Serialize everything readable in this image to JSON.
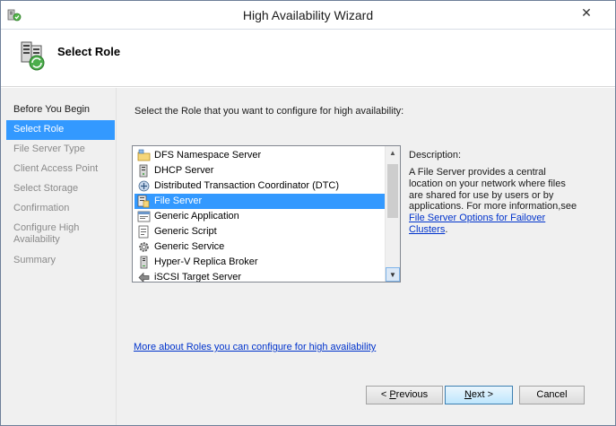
{
  "window": {
    "title": "High Availability Wizard",
    "close_glyph": "✕"
  },
  "header": {
    "title": "Select Role"
  },
  "nav": {
    "items": [
      {
        "label": "Before You Begin",
        "state": "done"
      },
      {
        "label": "Select Role",
        "state": "active"
      },
      {
        "label": "File Server Type",
        "state": "pending"
      },
      {
        "label": "Client Access Point",
        "state": "pending"
      },
      {
        "label": "Select Storage",
        "state": "pending"
      },
      {
        "label": "Confirmation",
        "state": "pending"
      },
      {
        "label": "Configure High Availability",
        "state": "pending"
      },
      {
        "label": "Summary",
        "state": "pending"
      }
    ]
  },
  "main": {
    "instruction": "Select the Role that you want to configure for high availability:",
    "roles": [
      {
        "label": "DFS Namespace Server",
        "icon": "dfs-namespace-icon"
      },
      {
        "label": "DHCP Server",
        "icon": "dhcp-server-icon"
      },
      {
        "label": "Distributed Transaction Coordinator (DTC)",
        "icon": "dtc-icon"
      },
      {
        "label": "File Server",
        "icon": "file-server-icon"
      },
      {
        "label": "Generic Application",
        "icon": "generic-application-icon"
      },
      {
        "label": "Generic Script",
        "icon": "generic-script-icon"
      },
      {
        "label": "Generic Service",
        "icon": "generic-service-icon"
      },
      {
        "label": "Hyper-V Replica Broker",
        "icon": "hyperv-replica-broker-icon"
      },
      {
        "label": "iSCSI Target Server",
        "icon": "iscsi-target-server-icon"
      }
    ],
    "selected_role": "File Server",
    "description_label": "Description:",
    "description_text": "A File Server provides a central location on your network where files are shared for use by users or by applications. For more information,see ",
    "description_link": "File Server Options for Failover Clusters",
    "description_end": ".",
    "more_link": "More about Roles you can configure for high availability"
  },
  "buttons": {
    "previous": {
      "prefix": "< ",
      "mnemonic": "P",
      "rest": "revious"
    },
    "next": {
      "mnemonic": "N",
      "rest": "ext >"
    },
    "cancel": "Cancel"
  },
  "colors": {
    "selection": "#3399ff",
    "link": "#0033cc",
    "panel": "#f0f0f0"
  }
}
